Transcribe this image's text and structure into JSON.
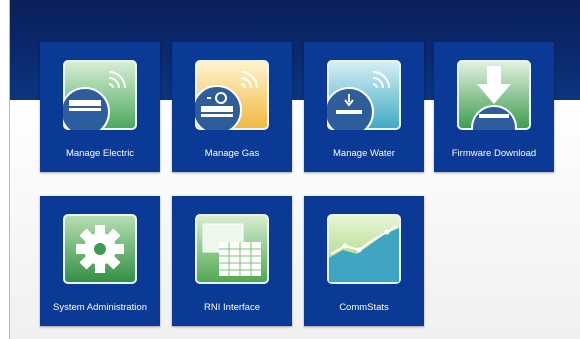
{
  "tiles": [
    {
      "label": "Manage Electric",
      "icon": "electric-meter-icon",
      "accent": "#4fae5c"
    },
    {
      "label": "Manage Gas",
      "icon": "gas-meter-icon",
      "accent": "#f2c046"
    },
    {
      "label": "Manage Water",
      "icon": "water-meter-icon",
      "accent": "#45b0c8"
    },
    {
      "label": "Firmware Download",
      "icon": "download-icon",
      "accent": "#4fae5c"
    },
    {
      "label": "System Administration",
      "icon": "gear-icon",
      "accent": "#4fae5c"
    },
    {
      "label": "RNI Interface",
      "icon": "spreadsheet-icon",
      "accent": "#5fb05a"
    },
    {
      "label": "CommStats",
      "icon": "line-chart-icon",
      "accent": "#45b0c8"
    }
  ]
}
